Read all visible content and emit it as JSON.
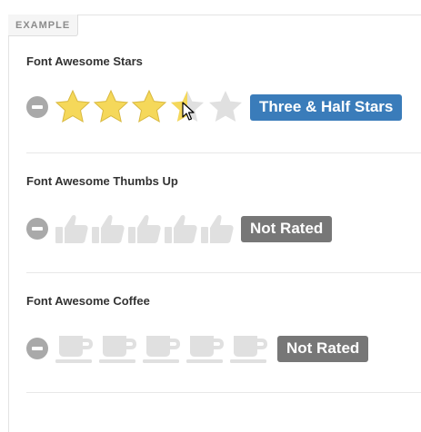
{
  "example_label": "EXAMPLE",
  "colors": {
    "star_filled": "#f5d85a",
    "star_empty": "#e0e0e0",
    "icon_empty": "#e0e0e0",
    "badge_active": "#3a7cba",
    "badge_inactive": "#777777",
    "clear_button": "#a9a9a9"
  },
  "sections": [
    {
      "title": "Font Awesome Stars",
      "icon": "star-icon",
      "max": 5,
      "rating": 3.5,
      "caption": "Three & Half Stars"
    },
    {
      "title": "Font Awesome Thumbs Up",
      "icon": "thumbs-up-icon",
      "max": 5,
      "rating": 0,
      "caption": "Not Rated"
    },
    {
      "title": "Font Awesome Coffee",
      "icon": "coffee-icon",
      "max": 5,
      "rating": 0,
      "caption": "Not Rated"
    }
  ]
}
